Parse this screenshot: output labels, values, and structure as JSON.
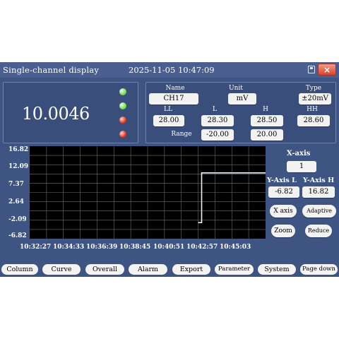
{
  "window": {
    "title": "Single-channel display",
    "datetime": "2025-11-05 10:47:09",
    "close_glyph": "×",
    "save_icon": "save-icon"
  },
  "reading": {
    "value": "10.0046",
    "indicators": [
      {
        "name": "led-1",
        "status": "green"
      },
      {
        "name": "led-2",
        "status": "green"
      },
      {
        "name": "led-3",
        "status": "red"
      },
      {
        "name": "led-4",
        "status": "red"
      }
    ]
  },
  "channel": {
    "name_label": "Name",
    "name": "CH17",
    "unit_label": "Unit",
    "unit": "mV",
    "type_label": "Type",
    "type": "±20mV",
    "ll_label": "LL",
    "ll": "28.00",
    "l_label": "L",
    "l": "28.30",
    "h_label": "H",
    "h": "28.50",
    "hh_label": "HH",
    "hh": "28.60",
    "range_label": "Range",
    "range_low": "-20.00",
    "range_high": "20.00"
  },
  "chart_data": {
    "type": "line",
    "y_ticks": [
      "16.82",
      "12.09",
      "7.37",
      "2.64",
      "-2.09",
      "-6.82"
    ],
    "x_ticks": [
      "10:32:27",
      "10:34:33",
      "10:36:39",
      "10:38:45",
      "10:40:51",
      "10:42:57",
      "10:45:03"
    ],
    "ylim": [
      -6.82,
      16.82
    ],
    "xlim": [
      "10:32:27",
      "10:47:09"
    ],
    "grid": true,
    "series": [
      {
        "color": "#e8f6ff",
        "points": [
          {
            "x": "10:42:57",
            "y": -2.7
          },
          {
            "x": "10:43:10",
            "y": -2.7
          },
          {
            "x": "10:43:10",
            "y": 10.0
          },
          {
            "x": "10:47:09",
            "y": 10.0
          }
        ]
      }
    ]
  },
  "chart_controls": {
    "x_axis_label": "X-axis",
    "x_axis_value": "1",
    "y_axis_l_label": "Y-Axis L",
    "y_axis_h_label": "Y-Axis H",
    "y_axis_l": "-6.82",
    "y_axis_h": "16.82",
    "x_axis_btn": "X axis",
    "adaptive_btn": "Adaptive",
    "zoom_btn": "Zoom",
    "reduce_btn": "Reduce"
  },
  "nav": {
    "column": "Column",
    "curve": "Curve",
    "overall": "Overall",
    "alarm": "Alarm",
    "export": "Export",
    "parameter": "Parameter",
    "system": "System",
    "page_down": "Page down"
  }
}
